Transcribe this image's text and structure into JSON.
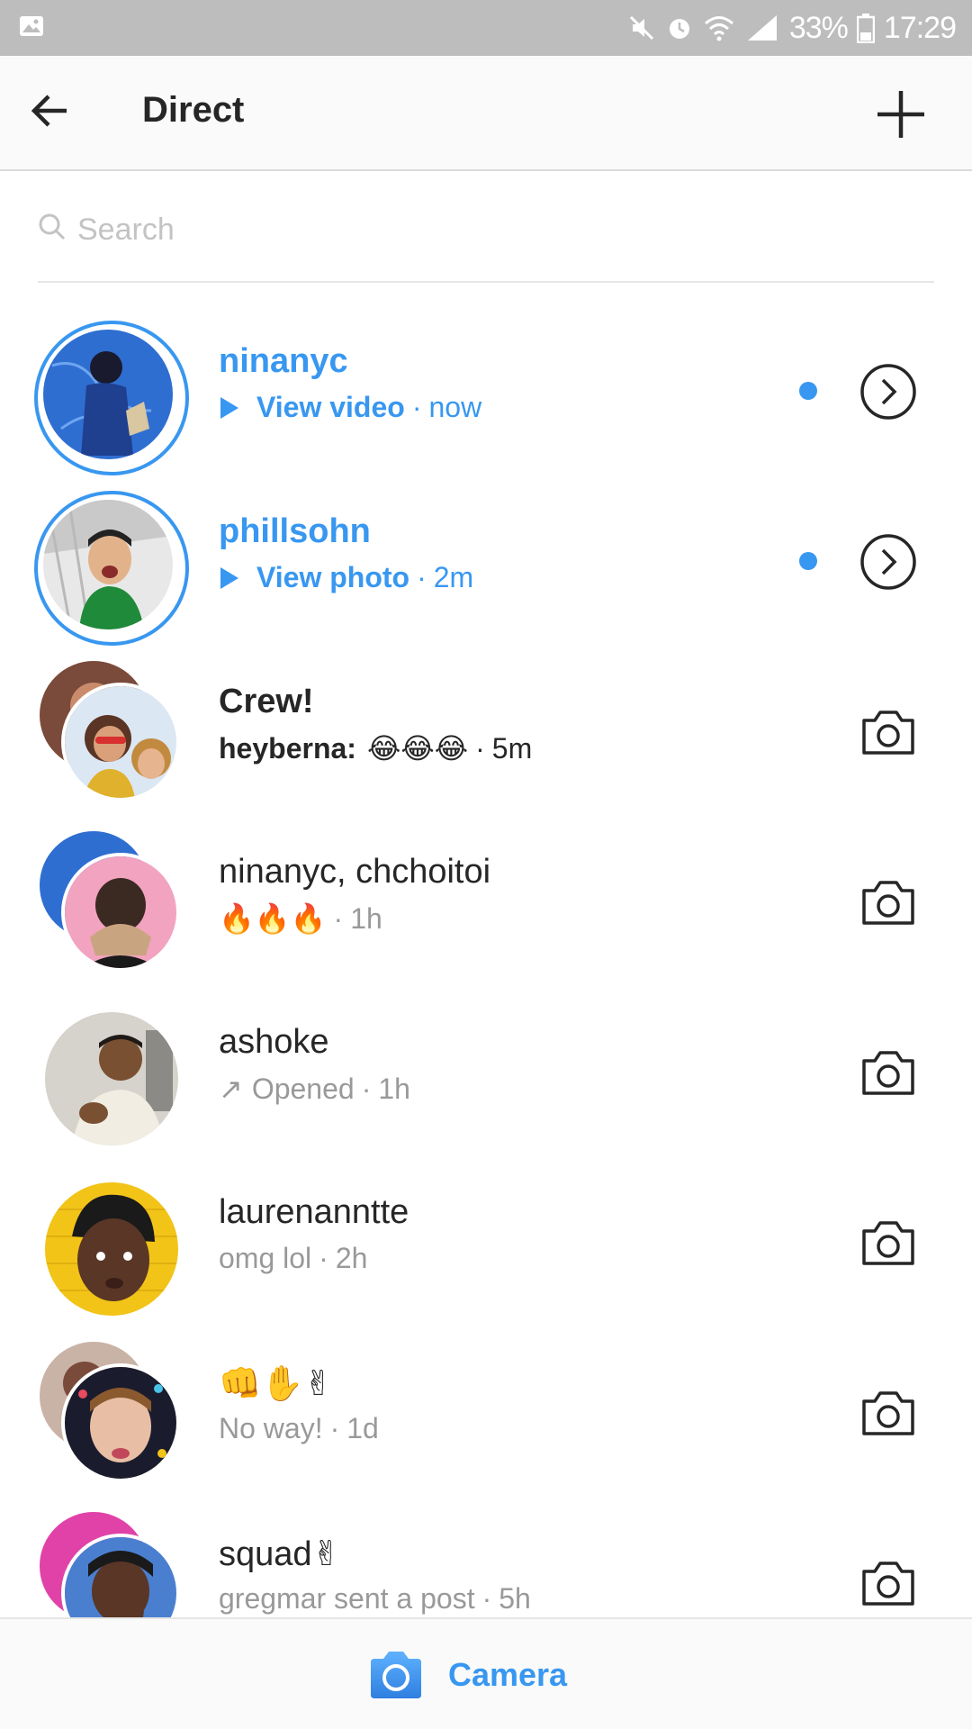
{
  "status_bar": {
    "battery": "33%",
    "time": "17:29"
  },
  "header": {
    "title": "Direct"
  },
  "search": {
    "placeholder": "Search"
  },
  "threads": [
    {
      "name": "ninanyc",
      "prefix": "",
      "sub": "View video",
      "time": "now",
      "unread": true,
      "action": "arrow"
    },
    {
      "name": "phillsohn",
      "prefix": "",
      "sub": "View photo",
      "time": "2m",
      "unread": true,
      "action": "arrow"
    },
    {
      "name": "Crew!",
      "prefix": "heyberna:",
      "sub": "😂😂😂",
      "time": "5m",
      "unread": false,
      "action": "camera"
    },
    {
      "name": "ninanyc, chchoitoi",
      "prefix": "",
      "sub": "🔥🔥🔥",
      "time": "1h",
      "unread": false,
      "action": "camera"
    },
    {
      "name": "ashoke",
      "prefix": "↗",
      "sub": "Opened",
      "time": "1h",
      "unread": false,
      "action": "camera"
    },
    {
      "name": "laurenanntte",
      "prefix": "",
      "sub": "omg lol",
      "time": "2h",
      "unread": false,
      "action": "camera"
    },
    {
      "name": "👊✋✌",
      "prefix": "",
      "sub": "No way!",
      "time": "1d",
      "unread": false,
      "action": "camera"
    },
    {
      "name": "squad✌",
      "prefix": "",
      "sub": "gregmar sent a post",
      "time": "5h",
      "unread": false,
      "action": "camera"
    }
  ],
  "separator": "·",
  "bottom_bar": {
    "camera_label": "Camera"
  },
  "colors": {
    "accent": "#3897f0",
    "text": "#262626",
    "muted": "#999999"
  }
}
